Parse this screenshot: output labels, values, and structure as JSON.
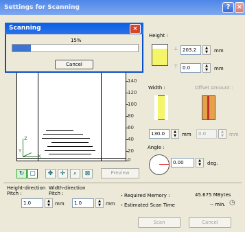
{
  "window": {
    "title": "Settings for Scanning",
    "help": "?",
    "close": "×"
  },
  "progress_dialog": {
    "title": "Scanning",
    "close": "×",
    "percent_text": "15%",
    "progress": 0.15,
    "cancel_label": "Cancel"
  },
  "ruler": {
    "ticks": [
      "140",
      "120",
      "100",
      "80",
      "60",
      "40",
      "20",
      "0"
    ]
  },
  "axes": {
    "z": "Z",
    "y": "Y",
    "x": "X"
  },
  "toolbar": {
    "preview_label": "Preview"
  },
  "height_section": {
    "label": "Height :",
    "value": "203.2",
    "unit": "mm",
    "offset_value": "0.0",
    "offset_unit": "mm"
  },
  "width_section": {
    "label": "Width :",
    "offset_label": "Offset Amount :",
    "value": "130.0",
    "unit": "mm",
    "offset_value": "0.0",
    "offset_unit": "mm"
  },
  "angle_section": {
    "label": "Angle :",
    "value": "0.00",
    "unit": "deg."
  },
  "pitch": {
    "height_label": "Height-direction\nPitch :",
    "width_label": "Width-direction\nPitch :",
    "height_value": "1.0",
    "height_unit": "mm",
    "width_value": "1.0",
    "width_unit": "mm"
  },
  "info": {
    "memory_label": "・Required Memory :",
    "memory_value": "45.675 MBytes",
    "time_label": "・Estimated Scan Time",
    "time_value": "-- min."
  },
  "buttons": {
    "scan": "Scan",
    "cancel": "Cancel"
  }
}
